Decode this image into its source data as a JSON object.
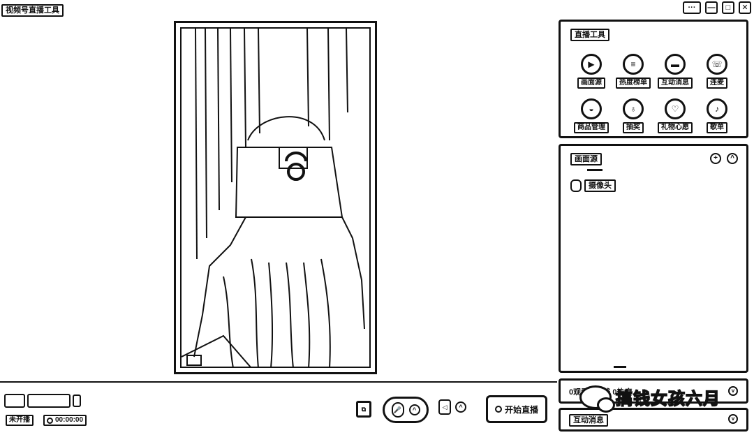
{
  "app": {
    "title": "视频号直播工具"
  },
  "window": {
    "controls": [
      "···",
      "—",
      "□",
      "✕"
    ]
  },
  "live_tools": {
    "title": "直播工具",
    "items": [
      {
        "label": "画面源",
        "icon": "screen-source-icon",
        "glyph": "▶"
      },
      {
        "label": "热度榜单",
        "icon": "ranking-list-icon",
        "glyph": "≡"
      },
      {
        "label": "互动消息",
        "icon": "chat-message-icon",
        "glyph": "▬"
      },
      {
        "label": "连麦",
        "icon": "phone-link-icon",
        "glyph": "☏"
      },
      {
        "label": "商品管理",
        "icon": "product-bag-icon",
        "glyph": "◒"
      },
      {
        "label": "抽奖",
        "icon": "lottery-gift-icon",
        "glyph": "♁"
      },
      {
        "label": "礼物心愿",
        "icon": "gift-wish-icon",
        "glyph": "♡"
      },
      {
        "label": "歌单",
        "icon": "music-note-icon",
        "glyph": "♪"
      }
    ]
  },
  "source_panel": {
    "title": "画面源",
    "add_glyph": "+",
    "collapse_glyph": "^",
    "items": [
      {
        "label": "摄像头"
      }
    ]
  },
  "stats_panel": {
    "text": "0观看 0在线 0热度",
    "chevron": "v"
  },
  "messages_panel": {
    "title": "互动消息",
    "chevron": "v"
  },
  "watermark": {
    "text": "搞钱女孩六月"
  },
  "bottom": {
    "status": "未开播",
    "timer": "00:00:00",
    "copy_glyph": "⧉",
    "mic_glyph": "🎤",
    "mic_arrow": "^",
    "speaker_glyph": "◁",
    "speaker_arrow": "^",
    "start_label": "开始直播"
  }
}
